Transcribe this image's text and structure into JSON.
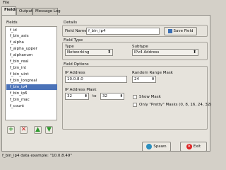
{
  "menubar": {
    "file": "File"
  },
  "tabs": [
    {
      "label": "Fields",
      "active": true
    },
    {
      "label": "Output",
      "active": false
    },
    {
      "label": "Message Log",
      "active": false
    }
  ],
  "fields": {
    "heading": "Fields",
    "items": [
      "f_id",
      "f_bin_asis",
      "f_alpha",
      "f_alpha_upper",
      "f_alphanum",
      "f_bin_real",
      "f_bin_int",
      "f_bin_uint",
      "f_bin_ip4",
      "f_bin_ip6",
      "f_bin_mac",
      "f_count"
    ],
    "selected": "f_bin_ip4",
    "list_display": [
      "f_id",
      "f_bin_asis",
      "f_alpha",
      "f_alpha_upper",
      "f_alphanum",
      "f_bin_real",
      "f_bin_int",
      "f_bin_uint",
      "f_bin_longreal",
      "f_bin_ip4",
      "f_bin_ip6",
      "f_bin_mac",
      "f_count"
    ]
  },
  "details": {
    "heading": "Details",
    "field_name_label": "Field Name",
    "field_name_value": "f_bin_ip4",
    "save_label": "Save Field",
    "field_type": {
      "heading": "Field Type",
      "type_label": "Type",
      "type_value": "Networking",
      "subtype_label": "Subtype",
      "subtype_value": "IPv4 Address"
    },
    "field_options": {
      "heading": "Field Options",
      "ip_label": "IP Address",
      "ip_value": "10.0.8.0",
      "mask_label": "Random Range Mask",
      "mask_value": "24",
      "ip_mask_label": "IP Address Mask",
      "mask_from": "32",
      "to_label": "to",
      "mask_to": "32",
      "show_mask_label": "Show Mask",
      "pretty_label": "Only \"Pretty\" Masks (0, 8, 16, 24, 32)"
    }
  },
  "actions": {
    "spawn_label": "Spawn",
    "exit_label": "Exit"
  },
  "status": "f_bin_ip4 data example: \"10.0.8.49\""
}
